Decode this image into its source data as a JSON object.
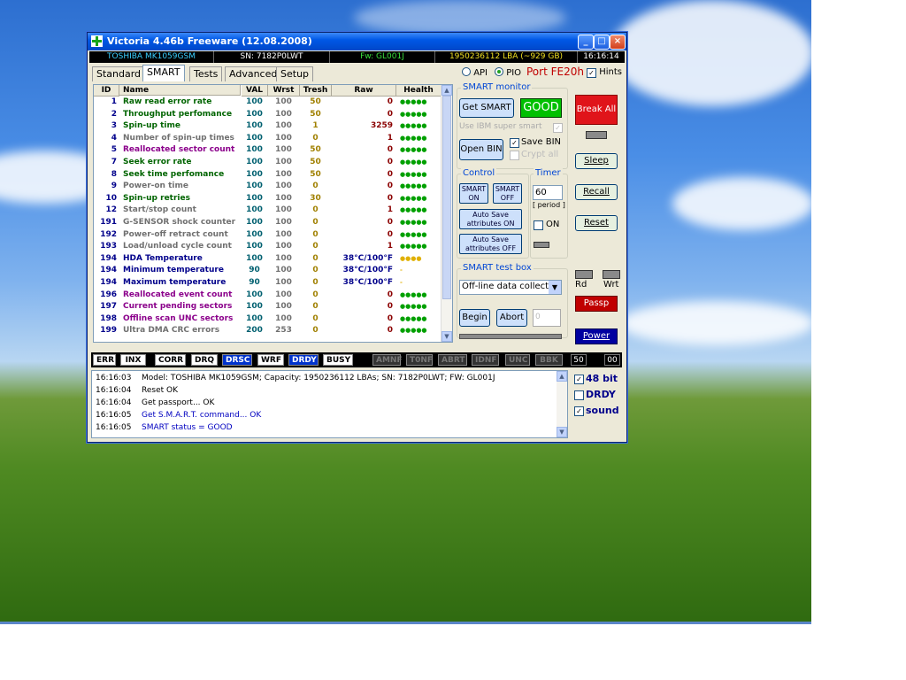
{
  "window": {
    "title": "Victoria 4.46b Freeware (12.08.2008)",
    "controls": {
      "minimize": "_",
      "maximize": "□",
      "close": "×"
    }
  },
  "infobar": {
    "model": "TOSHIBA MK1059GSM",
    "serial": "SN: 7182P0LWT",
    "firmware": "Fw: GL001J",
    "capacity": "1950236112 LBA (~929 GB)",
    "clock": "16:16:14"
  },
  "tabs": [
    "Standard",
    "SMART",
    "Tests",
    "Advanced",
    "Setup"
  ],
  "active_tab": "SMART",
  "mode": {
    "api": "API",
    "pio": "PIO",
    "selected": "PIO",
    "port": "Port FE20h",
    "hints": "Hints",
    "hints_checked": true
  },
  "smart_table": {
    "columns": [
      "ID",
      "Name",
      "VAL",
      "Wrst",
      "Tresh",
      "Raw",
      "Health"
    ],
    "rows": [
      {
        "id": "1",
        "name": "Raw read error rate",
        "val": "100",
        "wrst": "100",
        "tresh": "50",
        "raw": "0",
        "health": "●●●●●",
        "name_color": "#006400"
      },
      {
        "id": "2",
        "name": "Throughput perfomance",
        "val": "100",
        "wrst": "100",
        "tresh": "50",
        "raw": "0",
        "health": "●●●●●",
        "name_color": "#006400"
      },
      {
        "id": "3",
        "name": "Spin-up time",
        "val": "100",
        "wrst": "100",
        "tresh": "1",
        "raw": "3259",
        "health": "●●●●●",
        "name_color": "#006400"
      },
      {
        "id": "4",
        "name": "Number of spin-up times",
        "val": "100",
        "wrst": "100",
        "tresh": "0",
        "raw": "1",
        "health": "●●●●●",
        "name_color": "#707070"
      },
      {
        "id": "5",
        "name": "Reallocated sector count",
        "val": "100",
        "wrst": "100",
        "tresh": "50",
        "raw": "0",
        "health": "●●●●●",
        "name_color": "#8b008b"
      },
      {
        "id": "7",
        "name": "Seek error rate",
        "val": "100",
        "wrst": "100",
        "tresh": "50",
        "raw": "0",
        "health": "●●●●●",
        "name_color": "#006400"
      },
      {
        "id": "8",
        "name": "Seek time perfomance",
        "val": "100",
        "wrst": "100",
        "tresh": "50",
        "raw": "0",
        "health": "●●●●●",
        "name_color": "#006400"
      },
      {
        "id": "9",
        "name": "Power-on time",
        "val": "100",
        "wrst": "100",
        "tresh": "0",
        "raw": "0",
        "health": "●●●●●",
        "name_color": "#707070"
      },
      {
        "id": "10",
        "name": "Spin-up retries",
        "val": "100",
        "wrst": "100",
        "tresh": "30",
        "raw": "0",
        "health": "●●●●●",
        "name_color": "#006400"
      },
      {
        "id": "12",
        "name": "Start/stop count",
        "val": "100",
        "wrst": "100",
        "tresh": "0",
        "raw": "1",
        "health": "●●●●●",
        "name_color": "#707070"
      },
      {
        "id": "191",
        "name": "G-SENSOR shock counter",
        "val": "100",
        "wrst": "100",
        "tresh": "0",
        "raw": "0",
        "health": "●●●●●",
        "name_color": "#707070"
      },
      {
        "id": "192",
        "name": "Power-off retract count",
        "val": "100",
        "wrst": "100",
        "tresh": "0",
        "raw": "0",
        "health": "●●●●●",
        "name_color": "#707070"
      },
      {
        "id": "193",
        "name": "Load/unload cycle count",
        "val": "100",
        "wrst": "100",
        "tresh": "0",
        "raw": "1",
        "health": "●●●●●",
        "name_color": "#707070"
      },
      {
        "id": "194",
        "name": "HDA Temperature",
        "val": "100",
        "wrst": "100",
        "tresh": "0",
        "raw": "38°C/100°F",
        "health": "●●●●",
        "name_color": "#00008b",
        "raw_color": "#00008b",
        "health_color": "#e0b000"
      },
      {
        "id": "194",
        "name": "Minimum temperature",
        "val": "90",
        "wrst": "100",
        "tresh": "0",
        "raw": "38°C/100°F",
        "health": "-",
        "name_color": "#00008b",
        "raw_color": "#00008b",
        "health_color": "#e0b000"
      },
      {
        "id": "194",
        "name": "Maximum temperature",
        "val": "90",
        "wrst": "100",
        "tresh": "0",
        "raw": "38°C/100°F",
        "health": "-",
        "name_color": "#00008b",
        "raw_color": "#00008b",
        "health_color": "#e0b000"
      },
      {
        "id": "196",
        "name": "Reallocated event count",
        "val": "100",
        "wrst": "100",
        "tresh": "0",
        "raw": "0",
        "health": "●●●●●",
        "name_color": "#8b008b"
      },
      {
        "id": "197",
        "name": "Current pending sectors",
        "val": "100",
        "wrst": "100",
        "tresh": "0",
        "raw": "0",
        "health": "●●●●●",
        "name_color": "#8b008b"
      },
      {
        "id": "198",
        "name": "Offline scan UNC sectors",
        "val": "100",
        "wrst": "100",
        "tresh": "0",
        "raw": "0",
        "health": "●●●●●",
        "name_color": "#8b008b"
      },
      {
        "id": "199",
        "name": "Ultra DMA CRC errors",
        "val": "200",
        "wrst": "253",
        "tresh": "0",
        "raw": "0",
        "health": "●●●●●",
        "name_color": "#707070"
      }
    ]
  },
  "smart_monitor": {
    "label": "SMART monitor",
    "get_smart": "Get SMART",
    "status": "GOOD",
    "status_color": "#00c000",
    "use_ibm": "Use IBM super smart",
    "open_bin": "Open BIN",
    "save_bin": "Save BIN",
    "save_bin_checked": true,
    "crypt": "Crypt all"
  },
  "control": {
    "label": "Control",
    "smart_on": "SMART ON",
    "smart_off": "SMART OFF",
    "auto_save_on": "Auto Save attributes ON",
    "auto_save_off": "Auto Save attributes OFF"
  },
  "timer": {
    "label": "Timer",
    "value": "60",
    "period": "[ period ]",
    "on": "ON"
  },
  "smart_test": {
    "label": "SMART test box",
    "selected": "Off-line data collect",
    "begin": "Begin",
    "abort": "Abort",
    "count": "0"
  },
  "side": {
    "break_all": "Break All",
    "sleep": "Sleep",
    "recall": "Recall",
    "reset": "Reset",
    "rd": "Rd",
    "wrt": "Wrt",
    "passp": "Passp",
    "power": "Power"
  },
  "status_flags": [
    {
      "label": "ERR",
      "active": true,
      "style": "white"
    },
    {
      "label": "INX",
      "active": true,
      "style": "white"
    },
    {
      "label": "CORR",
      "active": true,
      "style": "white"
    },
    {
      "label": "DRQ",
      "active": true,
      "style": "white"
    },
    {
      "label": "DRSC",
      "active": true,
      "style": "blue"
    },
    {
      "label": "WRF",
      "active": true,
      "style": "white"
    },
    {
      "label": "DRDY",
      "active": true,
      "style": "blue"
    },
    {
      "label": "BUSY",
      "active": true,
      "style": "white"
    },
    {
      "label": "AMNF",
      "active": false,
      "style": "dim"
    },
    {
      "label": "T0NF",
      "active": false,
      "style": "dim"
    },
    {
      "label": "ABRT",
      "active": false,
      "style": "dim"
    },
    {
      "label": "IDNF",
      "active": false,
      "style": "dim"
    },
    {
      "label": "UNC",
      "active": false,
      "style": "dim"
    },
    {
      "label": "BBK",
      "active": false,
      "style": "dim"
    }
  ],
  "status_right": {
    "left": "50",
    "right": "00"
  },
  "log": [
    {
      "time": "16:16:03",
      "text": "Model: TOSHIBA MK1059GSM; Capacity: 1950236112 LBAs; SN: 7182P0LWT; FW: GL001J",
      "color": "#000"
    },
    {
      "time": "16:16:04",
      "text": "Reset OK",
      "color": "#000"
    },
    {
      "time": "16:16:04",
      "text": "Get passport... OK",
      "color": "#000"
    },
    {
      "time": "16:16:05",
      "text": "Get S.M.A.R.T. command... OK",
      "color": "#0000c0"
    },
    {
      "time": "16:16:05",
      "text": "SMART status = GOOD",
      "color": "#0000c0"
    }
  ],
  "options": {
    "bit48": "48 bit",
    "bit48_checked": true,
    "drdy": "DRDY",
    "drdy_checked": false,
    "sound": "sound",
    "sound_checked": true
  }
}
